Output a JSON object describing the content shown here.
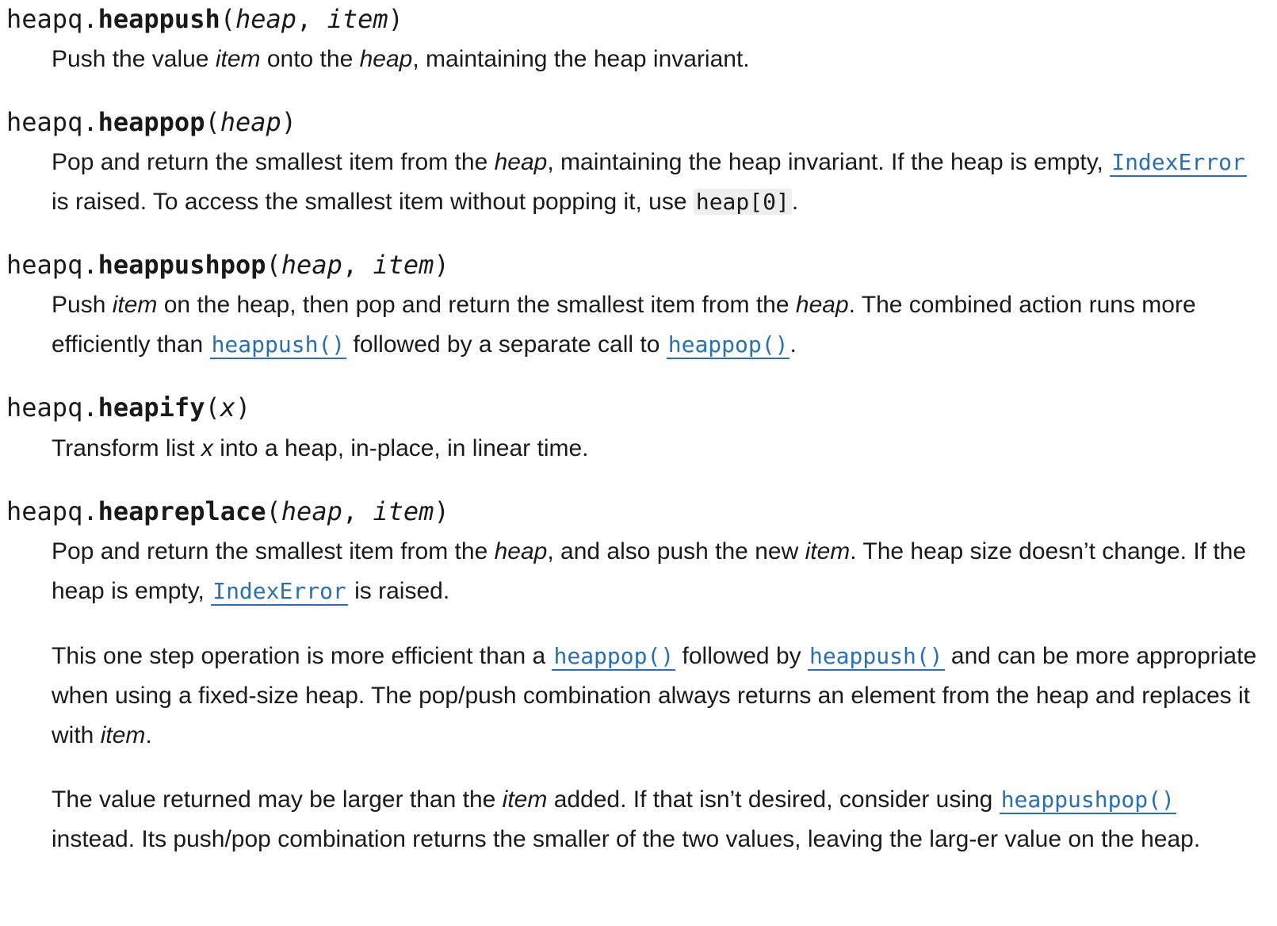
{
  "entries": {
    "heappush": {
      "module": "heapq.",
      "name": "heappush",
      "open": "(",
      "close": ")",
      "param1": "heap",
      "sep": ", ",
      "param2": "item",
      "d1": "Push the value ",
      "d1_em1": "item",
      "d2": " onto the ",
      "d2_em2": "heap",
      "d3": ", maintaining the heap invariant."
    },
    "heappop": {
      "module": "heapq.",
      "name": "heappop",
      "open": "(",
      "close": ")",
      "param1": "heap",
      "d1": "Pop and return the smallest item from the ",
      "d1_em": "heap",
      "d2": ", maintaining the heap invariant. If the heap is empty, ",
      "link": "IndexError",
      "d3": " is raised. To access the smallest item without popping it, use ",
      "code": "heap[0]",
      "d4": "."
    },
    "heappushpop": {
      "module": "heapq.",
      "name": "heappushpop",
      "open": "(",
      "close": ")",
      "param1": "heap",
      "sep": ", ",
      "param2": "item",
      "d1": "Push ",
      "d1_em": "item",
      "d2": " on the heap, then pop and return the smallest item from the ",
      "d2_em": "heap",
      "d3": ". The combined action runs more efficiently than ",
      "link1": "heappush()",
      "d4": " followed by a separate call to ",
      "link2": "heappop()",
      "d5": "."
    },
    "heapify": {
      "module": "heapq.",
      "name": "heapify",
      "open": "(",
      "close": ")",
      "param1": "x",
      "d1": "Transform list ",
      "d1_em": "x",
      "d2": " into a heap, in-place, in linear time."
    },
    "heapreplace": {
      "module": "heapq.",
      "name": "heapreplace",
      "open": "(",
      "close": ")",
      "param1": "heap",
      "sep": ", ",
      "param2": "item",
      "p1_a": "Pop and return the smallest item from the ",
      "p1_em1": "heap",
      "p1_b": ", and also push the new ",
      "p1_em2": "item",
      "p1_c": ". The heap size doesn’t change. If the heap is empty, ",
      "p1_link": "IndexError",
      "p1_d": " is raised.",
      "p2_a": "This one step operation is more efficient than a ",
      "p2_link1": "heappop()",
      "p2_b": " followed by ",
      "p2_link2": "heappush()",
      "p2_c": " and can be more appropriate when using a fixed-size heap. The pop/push combination always returns an element from the heap and replaces it with ",
      "p2_em": "item",
      "p2_d": ".",
      "p3_a": "The value returned may be larger than the ",
      "p3_em": "item",
      "p3_b": " added. If that isn’t desired, consider using ",
      "p3_link": "heappushpop()",
      "p3_c": " instead. Its push/pop combination returns the smaller of the two values, leaving the larg-er value on the heap."
    }
  }
}
